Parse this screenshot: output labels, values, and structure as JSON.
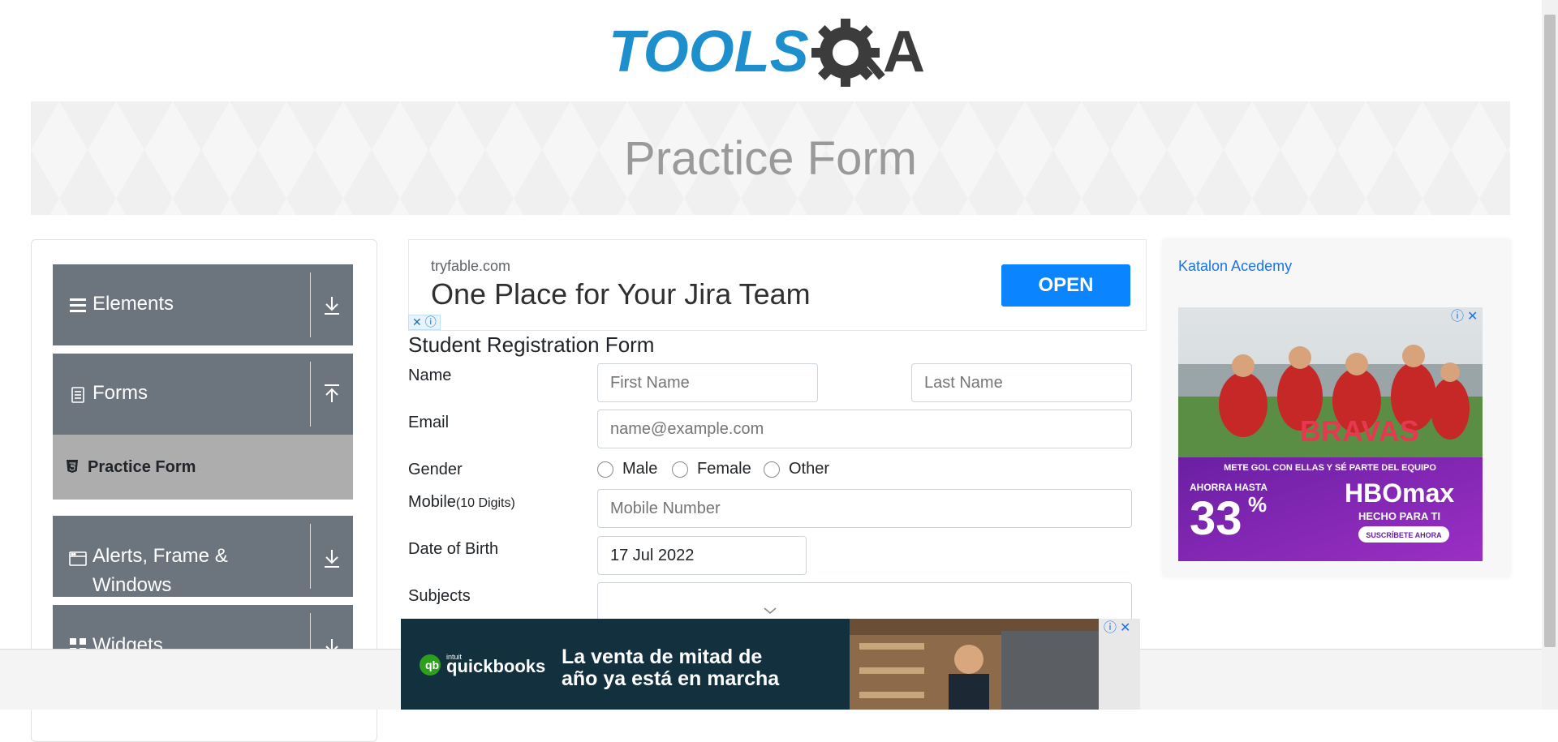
{
  "logo": {
    "text_tools": "TOOLS",
    "text_qa": "A",
    "colors": {
      "tools": "#1c8fcc",
      "qa": "#3c3c3c"
    }
  },
  "banner": {
    "title": "Practice Form"
  },
  "menu": {
    "groups": [
      {
        "label": "Elements",
        "icon": "hamburger-icon",
        "arrow": "download-icon"
      },
      {
        "label": "Forms",
        "icon": "document-icon",
        "arrow": "upload-icon"
      },
      {
        "label": "Alerts, Frame & Windows",
        "label_line1": "Alerts, Frame &",
        "label_line2": "Windows",
        "icon": "window-icon",
        "arrow": "download-icon"
      },
      {
        "label": "Widgets",
        "icon": "widgets-icon",
        "arrow": "download-icon"
      }
    ],
    "active_item": {
      "label": "Practice Form",
      "icon": "html5-icon"
    }
  },
  "ad_top": {
    "domain": "tryfable.com",
    "headline": "One Place for Your Jira Team",
    "button": "OPEN"
  },
  "form": {
    "title": "Student Registration Form",
    "name_label": "Name",
    "first_name_placeholder": "First Name",
    "last_name_placeholder": "Last Name",
    "email_label": "Email",
    "email_placeholder": "name@example.com",
    "gender_label": "Gender",
    "gender_options": [
      "Male",
      "Female",
      "Other"
    ],
    "mobile_label": "Mobile",
    "mobile_hint": "(10 Digits)",
    "mobile_placeholder": "Mobile Number",
    "dob_label": "Date of Birth",
    "dob_value": "17 Jul 2022",
    "subjects_label": "Subjects"
  },
  "ad_right": {
    "alt_text": "Katalon Acedemy",
    "promo_line": "METE GOL CON ELLAS Y SÉ PARTE DEL EQUIPO",
    "discount_label": "AHORRA HASTA",
    "discount_value": "33",
    "discount_unit": "%",
    "brand": "HBOmax",
    "tagline": "HECHO PARA TI",
    "cta": "SUSCRÍBETE AHORA",
    "show_title": "BRAVAS"
  },
  "ad_bottom": {
    "brand_top": "intuit",
    "brand": "quickbooks",
    "line1": "La venta de mitad de",
    "line2": "año ya está en marcha"
  }
}
